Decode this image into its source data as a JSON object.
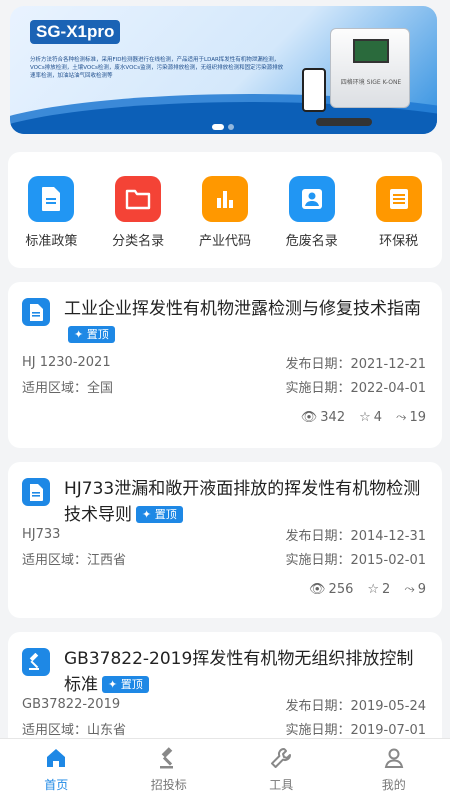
{
  "banner": {
    "brand": "SG-X1pro",
    "description": "分析方法符合各种检测标准，采用FID检测器进行在线检测，产品适用于LDAR挥发性有机物泄漏检测，VOCs排放检测，土壤VOCs检测，废水VOCs监测，污染源排放检测，无组织排放检测和固定污染源排放速率检测，加油站油气回收检测等",
    "device_label": "四格环境 SIGE K-ONE",
    "page_count": 2,
    "active_page": 1
  },
  "quick_links": [
    {
      "label": "标准政策",
      "icon": "document-icon",
      "color": "#2196f3"
    },
    {
      "label": "分类名录",
      "icon": "folder-icon",
      "color": "#f44336"
    },
    {
      "label": "产业代码",
      "icon": "bar-chart-icon",
      "color": "#ff9800"
    },
    {
      "label": "危废名录",
      "icon": "person-icon",
      "color": "#2196f3"
    },
    {
      "label": "环保税",
      "icon": "tax-list-icon",
      "color": "#ff9800"
    }
  ],
  "standards": [
    {
      "title": "工业企业挥发性有机物泄露检测与修复技术指南",
      "pin": "置顶",
      "code": "HJ 1230-2021",
      "publish": "发布日期：2021-12-21",
      "region": "适用区域：全国",
      "effective": "实施日期：2022-04-01",
      "views": "342",
      "favorites": "4",
      "shares": "19",
      "icon": "document-icon"
    },
    {
      "title": "HJ733泄漏和敞开液面排放的挥发性有机物检测技术导则",
      "pin": "置顶",
      "code": "HJ733",
      "publish": "发布日期：2014-12-31",
      "region": "适用区域：江西省",
      "effective": "实施日期：2015-02-01",
      "views": "256",
      "favorites": "2",
      "shares": "9",
      "icon": "document-icon"
    },
    {
      "title": "GB37822-2019挥发性有机物无组织排放控制标准",
      "pin": "置顶",
      "code": "GB37822-2019",
      "publish": "发布日期：2019-05-24",
      "region": "适用区域：山东省",
      "effective": "实施日期：2019-07-01",
      "icon": "gavel-icon"
    }
  ],
  "tabbar": [
    {
      "label": "首页",
      "icon": "home-icon",
      "active": true
    },
    {
      "label": "招投标",
      "icon": "gavel-icon",
      "active": false
    },
    {
      "label": "工具",
      "icon": "wrench-icon",
      "active": false
    },
    {
      "label": "我的",
      "icon": "user-icon",
      "active": false
    }
  ],
  "colors": {
    "accent": "#1e88e5",
    "inactive": "#777777"
  }
}
